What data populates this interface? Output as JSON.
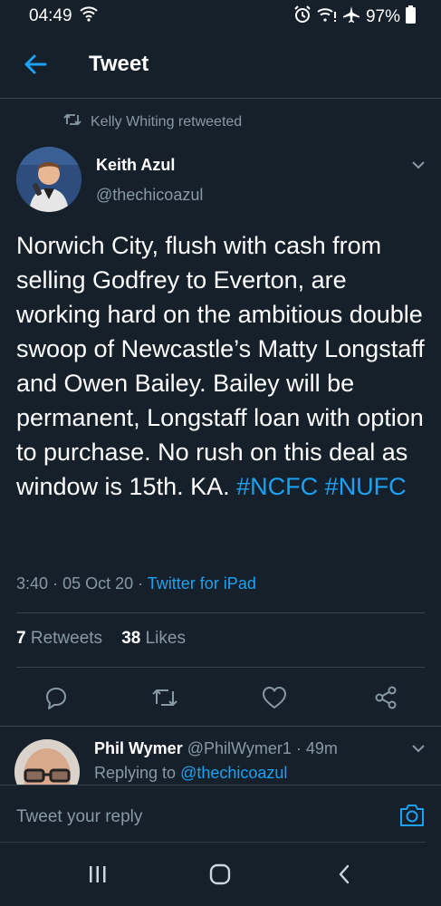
{
  "status_bar": {
    "time": "04:49",
    "battery": "97%"
  },
  "header": {
    "title": "Tweet"
  },
  "retweet_context": {
    "text": "Kelly Whiting retweeted"
  },
  "tweet": {
    "author_name": "Keith Azul",
    "handle": "@thechicoazul",
    "text_main": "Norwich City, flush with cash from selling Godfrey to Everton, are working hard on the ambitious double swoop of Newcastle’s Matty Longstaff and Owen Bailey. Bailey will be permanent, Longstaff loan with option to purchase. No rush on this deal as window is 15th. KA.",
    "hashtag1": "#NCFC",
    "hashtag2": "#NUFC",
    "time": "3:40",
    "date": "05 Oct 20",
    "source": "Twitter for iPad",
    "retweets_count": "7",
    "retweets_label": "Retweets",
    "likes_count": "38",
    "likes_label": "Likes"
  },
  "reply": {
    "name": "Phil Wymer",
    "handle": "@PhilWymer1",
    "time": "49m",
    "replying_prefix": "Replying to",
    "replying_to": "@thechicoazul"
  },
  "composer": {
    "placeholder": "Tweet your reply"
  },
  "colors": {
    "background": "#15202b",
    "accent": "#1da1f2",
    "secondary_text": "#8899a6",
    "divider": "#38444d"
  },
  "icons": [
    "back-arrow-icon",
    "retweet-icon",
    "chevron-down-icon",
    "reply-icon",
    "like-icon",
    "share-icon",
    "camera-icon",
    "recent-apps-icon",
    "home-icon",
    "back-nav-icon"
  ]
}
